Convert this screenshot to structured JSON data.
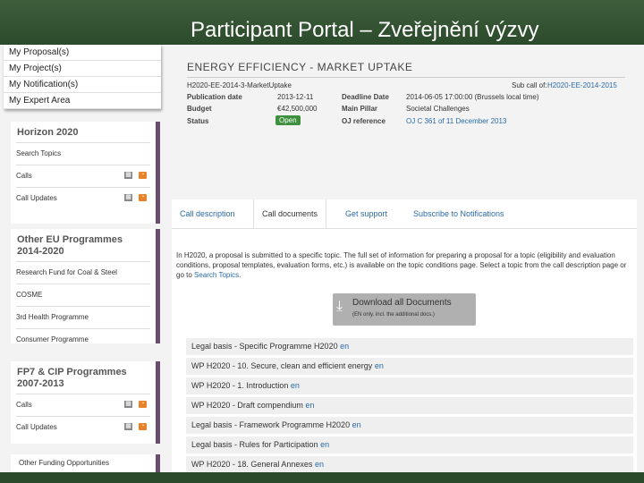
{
  "slide": {
    "title": "Participant Portal – Zveřejnění výzvy"
  },
  "user_menu": [
    "My Proposal(s)",
    "My Project(s)",
    "My Notification(s)",
    "My Expert Area"
  ],
  "sidebar": {
    "horizon": {
      "heading": "Horizon 2020",
      "items": [
        {
          "label": "Search Topics"
        },
        {
          "label": "Calls"
        },
        {
          "label": "Call Updates"
        }
      ]
    },
    "other_eu": {
      "heading": "Other EU Programmes 2014-2020",
      "items": [
        {
          "label": "Research Fund for Coal & Steel"
        },
        {
          "label": "COSME"
        },
        {
          "label": "3rd Health Programme"
        },
        {
          "label": "Consumer Programme"
        }
      ]
    },
    "fp7": {
      "heading": "FP7 & CIP Programmes 2007-2013",
      "items": [
        {
          "label": "Calls"
        },
        {
          "label": "Call Updates"
        }
      ]
    },
    "other_funding": {
      "label": "Other Funding Opportunities"
    }
  },
  "topic": {
    "title": "ENERGY EFFICIENCY - MARKET UPTAKE",
    "code": "H2020-EE-2014-3-MarketUptake",
    "subcall_label": "Sub call of:",
    "subcall_value": "H2020-EE-2014-2015",
    "publication_label": "Publication date",
    "publication_value": "2013-12-11",
    "deadline_label": "Deadline Date",
    "deadline_value": "2014-06-05 17:00:00 (Brussels local time)",
    "budget_label": "Budget",
    "budget_value": "€42,500,000",
    "pillar_label": "Main Pillar",
    "pillar_value": "Societal Challenges",
    "status_label": "Status",
    "status_value": "Open",
    "oj_label": "OJ reference",
    "oj_value": "OJ C 361 of 11 December 2013"
  },
  "tabs": [
    "Call description",
    "Call documents",
    "Get support",
    "Subscribe to Notifications"
  ],
  "content": {
    "para_text": "In H2020, a proposal is submitted to a specific topic. The full set of information for preparing a proposal for a topic (eligibility and evaluation conditions, proposal templates, evaluation forms, etc.) is available on the topic conditions page. Select a topic from the call description page or go to",
    "para_link": "Search Topics",
    "para_end": ".",
    "download_label": "Download all Documents",
    "download_note": "(EN only. incl. the additional docs.)"
  },
  "documents": [
    {
      "title": "Legal basis - Specific Programme H2020",
      "lang": "en"
    },
    {
      "title": "WP H2020 - 10. Secure, clean and efficient energy",
      "lang": "en"
    },
    {
      "title": "WP H2020 - 1. Introduction",
      "lang": "en"
    },
    {
      "title": "WP H2020 - Draft compendium",
      "lang": "en"
    },
    {
      "title": "Legal basis - Framework Programme H2020",
      "lang": "en"
    },
    {
      "title": "Legal basis - Rules for Participation",
      "lang": "en"
    },
    {
      "title": "WP H2020 - 18. General Annexes",
      "lang": "en"
    }
  ]
}
